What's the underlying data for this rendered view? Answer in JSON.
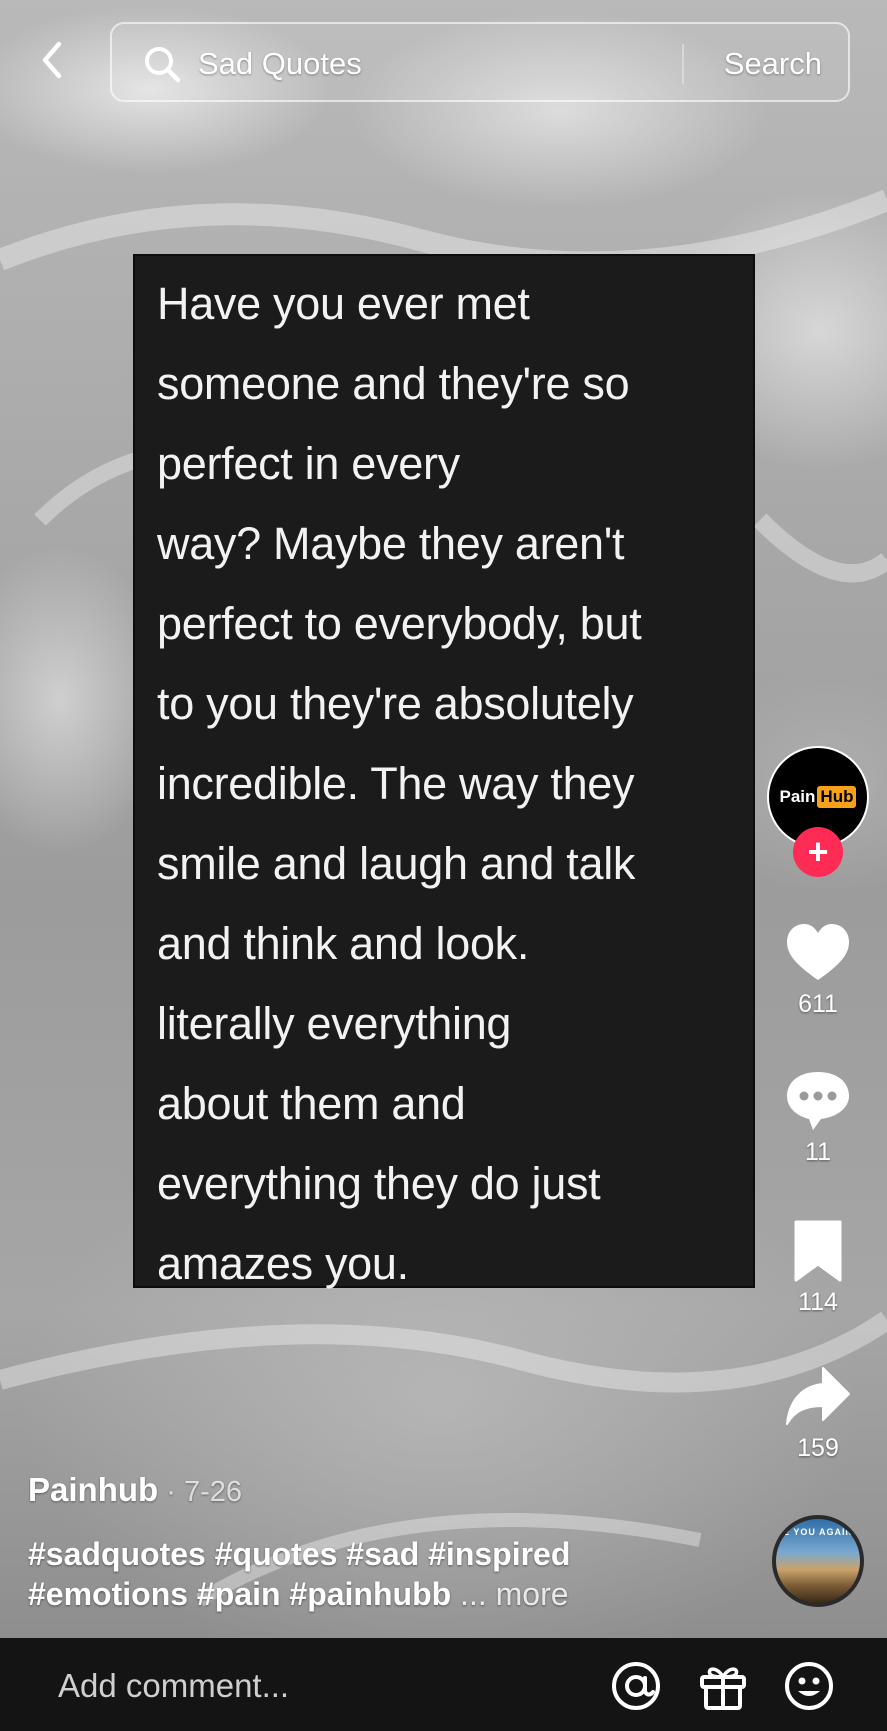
{
  "search": {
    "query": "Sad Quotes",
    "button_label": "Search"
  },
  "quote": {
    "lines": [
      "Have you ever met",
      "someone and they're so",
      "perfect in every",
      "way? Maybe they aren't",
      "perfect to everybody, but",
      "to you they're absolutely",
      "incredible. The way they",
      "smile and laugh and talk",
      "and think and look.",
      "literally everything",
      "about them and",
      "everything they do just",
      "amazes you."
    ]
  },
  "creator": {
    "avatar_text_1": "Pain",
    "avatar_text_2": "Hub",
    "follow_symbol": "+",
    "name": "Painhub",
    "date": " · 7-26"
  },
  "actions": {
    "likes": "611",
    "comments": "11",
    "bookmarks": "114",
    "shares": "159"
  },
  "caption": {
    "line1": "#sadquotes #quotes #sad #inspired",
    "line2": "#emotions #pain #painhubb",
    "more": " ... more"
  },
  "music": {
    "disc_label": "E YOU AGAIN"
  },
  "comment_bar": {
    "placeholder": "Add comment..."
  },
  "colors": {
    "follow": "#fe2c55",
    "hub_badge": "#f7a21a",
    "bar_bg": "#141414"
  }
}
